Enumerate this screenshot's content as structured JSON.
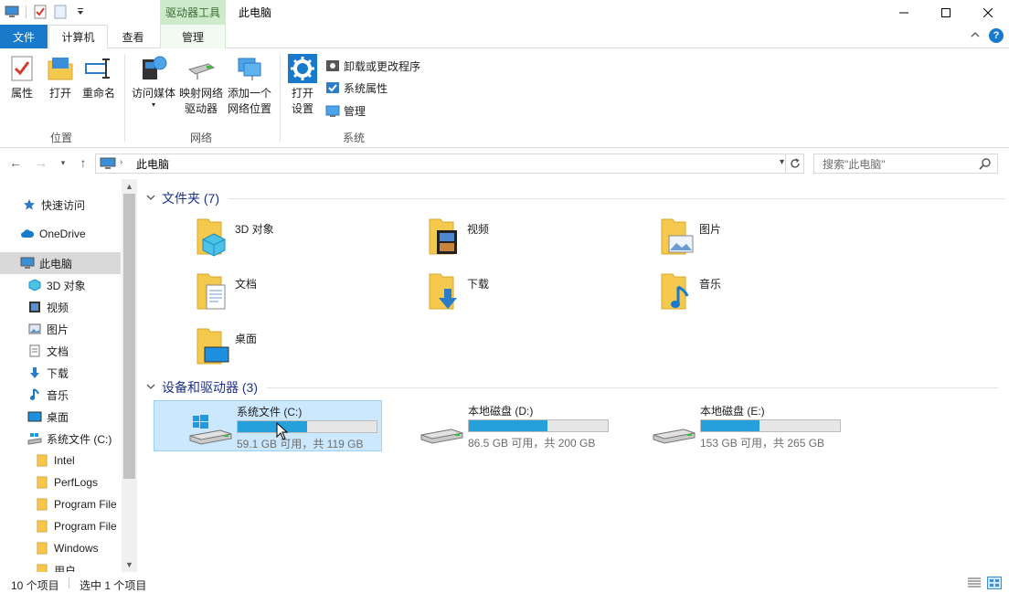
{
  "window": {
    "title": "此电脑",
    "context_tab": "驱动器工具",
    "minimize": "—",
    "maximize": "☐",
    "close": "✕"
  },
  "ribbon_tabs": {
    "file": "文件",
    "computer": "计算机",
    "view": "查看",
    "manage": "管理"
  },
  "ribbon": {
    "properties": "属性",
    "open": "打开",
    "rename": "重命名",
    "access_media": "访问媒体",
    "map_drive_1": "映射网络",
    "map_drive_2": "驱动器",
    "add_location_1": "添加一个",
    "add_location_2": "网络位置",
    "open_settings_1": "打开",
    "open_settings_2": "设置",
    "uninstall": "卸载或更改程序",
    "system_props": "系统属性",
    "manage": "管理",
    "group_location": "位置",
    "group_network": "网络",
    "group_system": "系统"
  },
  "address": {
    "path": "此电脑",
    "search_placeholder": "搜索\"此电脑\""
  },
  "nav": {
    "items": [
      {
        "label": "快速访问",
        "icon": "star-icon"
      },
      {
        "label": "OneDrive",
        "icon": "cloud-icon"
      },
      {
        "label": "此电脑",
        "icon": "pc-icon"
      },
      {
        "label": "3D 对象",
        "icon": "cube-icon"
      },
      {
        "label": "视频",
        "icon": "video-icon"
      },
      {
        "label": "图片",
        "icon": "picture-icon"
      },
      {
        "label": "文档",
        "icon": "document-icon"
      },
      {
        "label": "下载",
        "icon": "download-icon"
      },
      {
        "label": "音乐",
        "icon": "music-icon"
      },
      {
        "label": "桌面",
        "icon": "desktop-icon"
      },
      {
        "label": "系统文件 (C:)",
        "icon": "drive-icon"
      },
      {
        "label": "Intel",
        "icon": "folder-icon"
      },
      {
        "label": "PerfLogs",
        "icon": "folder-icon"
      },
      {
        "label": "Program File",
        "icon": "folder-icon"
      },
      {
        "label": "Program File",
        "icon": "folder-icon"
      },
      {
        "label": "Windows",
        "icon": "folder-icon"
      },
      {
        "label": "用户",
        "icon": "folder-icon"
      }
    ]
  },
  "content": {
    "folders_header": "文件夹 (7)",
    "folders": [
      {
        "label": "3D 对象",
        "icon": "cube-icon"
      },
      {
        "label": "视频",
        "icon": "video-icon"
      },
      {
        "label": "图片",
        "icon": "picture-icon"
      },
      {
        "label": "文档",
        "icon": "document-icon"
      },
      {
        "label": "下载",
        "icon": "download-icon"
      },
      {
        "label": "音乐",
        "icon": "music-icon"
      },
      {
        "label": "桌面",
        "icon": "desktop-icon"
      }
    ],
    "drives_header": "设备和驱动器 (3)",
    "drives": [
      {
        "name": "系统文件 (C:)",
        "size": "59.1 GB 可用，共 119 GB",
        "used_fraction": 0.503
      },
      {
        "name": "本地磁盘 (D:)",
        "size": "86.5 GB 可用，共 200 GB",
        "used_fraction": 0.567
      },
      {
        "name": "本地磁盘 (E:)",
        "size": "153 GB 可用，共 265 GB",
        "used_fraction": 0.423
      }
    ]
  },
  "status": {
    "count": "10 个项目",
    "selected": "选中 1 个项目"
  },
  "colors": {
    "accent": "#1979ca",
    "drive_fill": "#26a0da",
    "selection": "#cce8ff",
    "folder": "#f5c94e"
  }
}
